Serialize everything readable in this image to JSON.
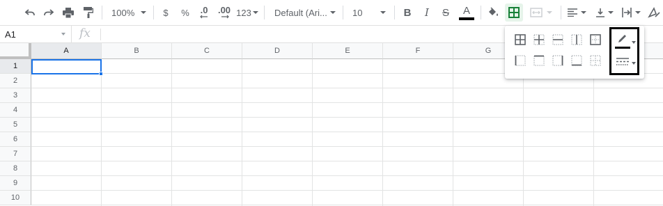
{
  "toolbar": {
    "undo": "undo-icon",
    "redo": "redo-icon",
    "print": "print-icon",
    "paint_format": "paint-format-icon",
    "zoom": "100%",
    "currency": "$",
    "percent": "%",
    "decrease_decimal": ".0",
    "increase_decimal": ".00",
    "more_formats": "123",
    "font": "Default (Ari...",
    "font_size": "10",
    "bold": "B",
    "italic": "I",
    "strikethrough": "S",
    "text_color_letter": "A"
  },
  "formula_bar": {
    "cell_ref": "A1",
    "fx": "fx",
    "value": ""
  },
  "sheet": {
    "columns": [
      "A",
      "B",
      "C",
      "D",
      "E",
      "F",
      "G"
    ],
    "rows": [
      "1",
      "2",
      "3",
      "4",
      "5",
      "6",
      "7",
      "8",
      "9",
      "10"
    ],
    "selected_cell": "A1"
  },
  "borders_menu": {
    "row1": [
      "all-borders-icon",
      "inner-borders-icon",
      "horizontal-borders-icon",
      "vertical-borders-icon",
      "outer-borders-icon"
    ],
    "row2": [
      "left-border-icon",
      "top-border-icon",
      "right-border-icon",
      "bottom-border-icon",
      "clear-borders-icon"
    ],
    "border_color": "#000000",
    "accent": "#1a73e8"
  }
}
